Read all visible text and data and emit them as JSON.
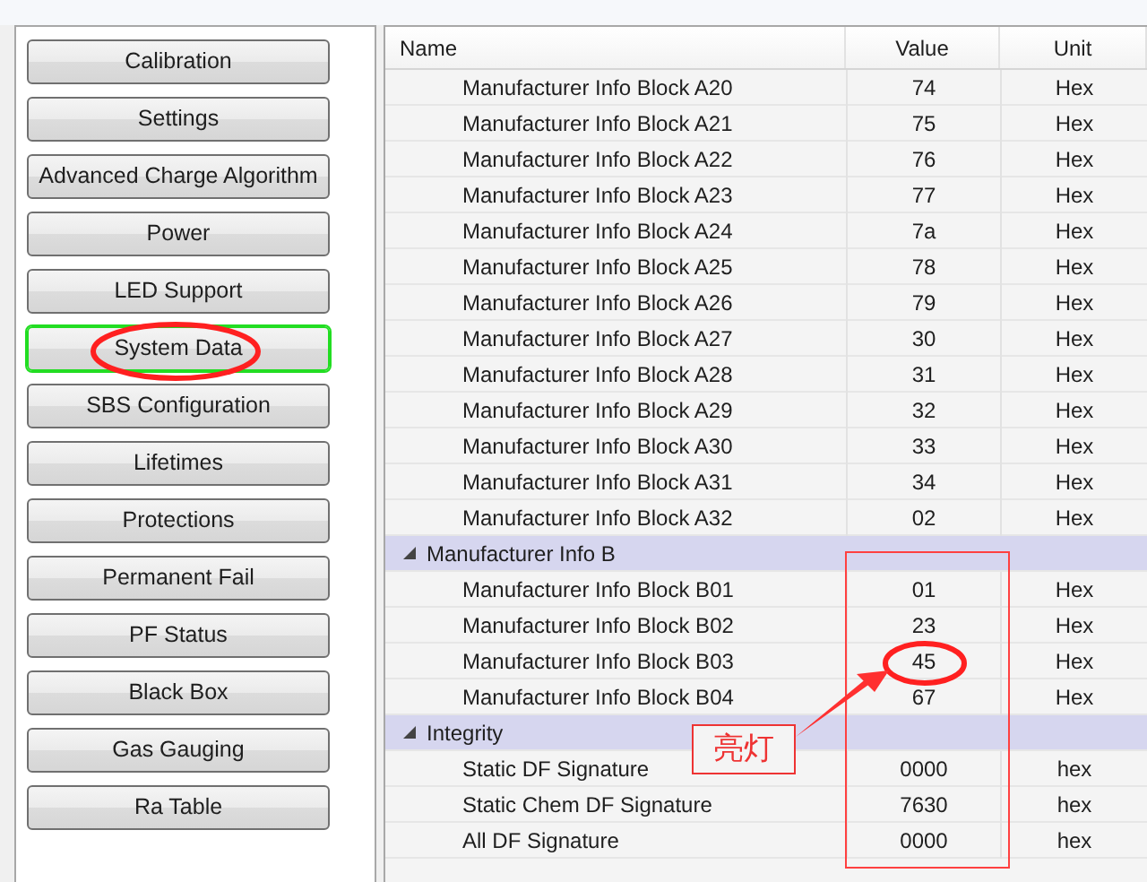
{
  "sidebar": {
    "buttons": [
      {
        "label": "Calibration",
        "selected": false
      },
      {
        "label": "Settings",
        "selected": false
      },
      {
        "label": "Advanced Charge Algorithm",
        "selected": false
      },
      {
        "label": "Power",
        "selected": false
      },
      {
        "label": "LED Support",
        "selected": false
      },
      {
        "label": "System Data",
        "selected": true
      },
      {
        "label": "SBS Configuration",
        "selected": false
      },
      {
        "label": "Lifetimes",
        "selected": false
      },
      {
        "label": "Protections",
        "selected": false
      },
      {
        "label": "Permanent Fail",
        "selected": false
      },
      {
        "label": "PF Status",
        "selected": false
      },
      {
        "label": "Black Box",
        "selected": false
      },
      {
        "label": "Gas Gauging",
        "selected": false
      },
      {
        "label": "Ra Table",
        "selected": false
      }
    ]
  },
  "table": {
    "columns": [
      "Name",
      "Value",
      "Unit"
    ],
    "rows": [
      {
        "kind": "item",
        "name": "Manufacturer Info Block A20",
        "value": "74",
        "unit": "Hex"
      },
      {
        "kind": "item",
        "name": "Manufacturer Info Block A21",
        "value": "75",
        "unit": "Hex"
      },
      {
        "kind": "item",
        "name": "Manufacturer Info Block A22",
        "value": "76",
        "unit": "Hex"
      },
      {
        "kind": "item",
        "name": "Manufacturer Info Block A23",
        "value": "77",
        "unit": "Hex"
      },
      {
        "kind": "item",
        "name": "Manufacturer Info Block A24",
        "value": "7a",
        "unit": "Hex"
      },
      {
        "kind": "item",
        "name": "Manufacturer Info Block A25",
        "value": "78",
        "unit": "Hex"
      },
      {
        "kind": "item",
        "name": "Manufacturer Info Block A26",
        "value": "79",
        "unit": "Hex"
      },
      {
        "kind": "item",
        "name": "Manufacturer Info Block A27",
        "value": "30",
        "unit": "Hex"
      },
      {
        "kind": "item",
        "name": "Manufacturer Info Block A28",
        "value": "31",
        "unit": "Hex"
      },
      {
        "kind": "item",
        "name": "Manufacturer Info Block A29",
        "value": "32",
        "unit": "Hex"
      },
      {
        "kind": "item",
        "name": "Manufacturer Info Block A30",
        "value": "33",
        "unit": "Hex"
      },
      {
        "kind": "item",
        "name": "Manufacturer Info Block A31",
        "value": "34",
        "unit": "Hex"
      },
      {
        "kind": "item",
        "name": "Manufacturer Info Block A32",
        "value": "02",
        "unit": "Hex"
      },
      {
        "kind": "group",
        "name": "Manufacturer Info B",
        "expanded": true
      },
      {
        "kind": "item",
        "name": "Manufacturer Info Block B01",
        "value": "01",
        "unit": "Hex"
      },
      {
        "kind": "item",
        "name": "Manufacturer Info Block B02",
        "value": "23",
        "unit": "Hex"
      },
      {
        "kind": "item",
        "name": "Manufacturer Info Block B03",
        "value": "45",
        "unit": "Hex"
      },
      {
        "kind": "item",
        "name": "Manufacturer Info Block B04",
        "value": "67",
        "unit": "Hex"
      },
      {
        "kind": "group",
        "name": "Integrity",
        "expanded": true
      },
      {
        "kind": "item",
        "name": "Static DF Signature",
        "value": "0000",
        "unit": "hex"
      },
      {
        "kind": "item",
        "name": "Static Chem DF Signature",
        "value": "7630",
        "unit": "hex"
      },
      {
        "kind": "item",
        "name": "All DF Signature",
        "value": "0000",
        "unit": "hex"
      }
    ]
  },
  "annotations": [
    {
      "kind": "ellipse"
    },
    {
      "kind": "rectangle"
    },
    {
      "kind": "ellipse"
    },
    {
      "kind": "arrow"
    },
    {
      "kind": "callout",
      "text": "亮灯"
    }
  ]
}
